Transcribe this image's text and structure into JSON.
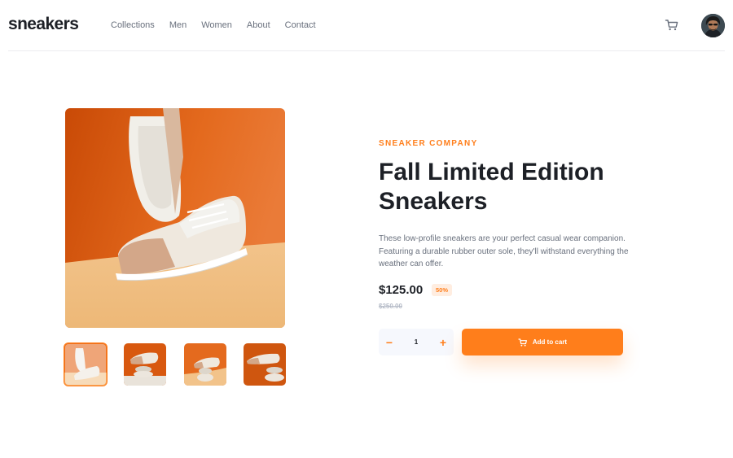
{
  "brand": {
    "logo": "sneakers"
  },
  "nav": {
    "items": [
      {
        "label": "Collections"
      },
      {
        "label": "Men"
      },
      {
        "label": "Women"
      },
      {
        "label": "About"
      },
      {
        "label": "Contact"
      }
    ]
  },
  "header": {
    "cart_icon": "cart-icon",
    "avatar_icon": "user-avatar"
  },
  "gallery": {
    "thumbnails_count": 4,
    "active_thumbnail": 1
  },
  "product": {
    "company": "SNEAKER COMPANY",
    "title": "Fall Limited Edition Sneakers",
    "description": "These low-profile sneakers are your perfect casual wear companion. Featuring a durable rubber outer sole, they'll withstand everything the weather can offer.",
    "price": "$125.00",
    "discount": "50%",
    "old_price": "$250.00"
  },
  "quantity": {
    "minus": "−",
    "value": "1",
    "plus": "+"
  },
  "cart_button": {
    "label": "Add to cart",
    "icon": "cart-icon"
  },
  "colors": {
    "accent": "#ff7e1b",
    "accent_light": "#ffede0",
    "text_dark": "#1d2026",
    "text_gray": "#69707d",
    "text_light": "#b6bcc8",
    "qty_bg": "#f6f8fd"
  }
}
